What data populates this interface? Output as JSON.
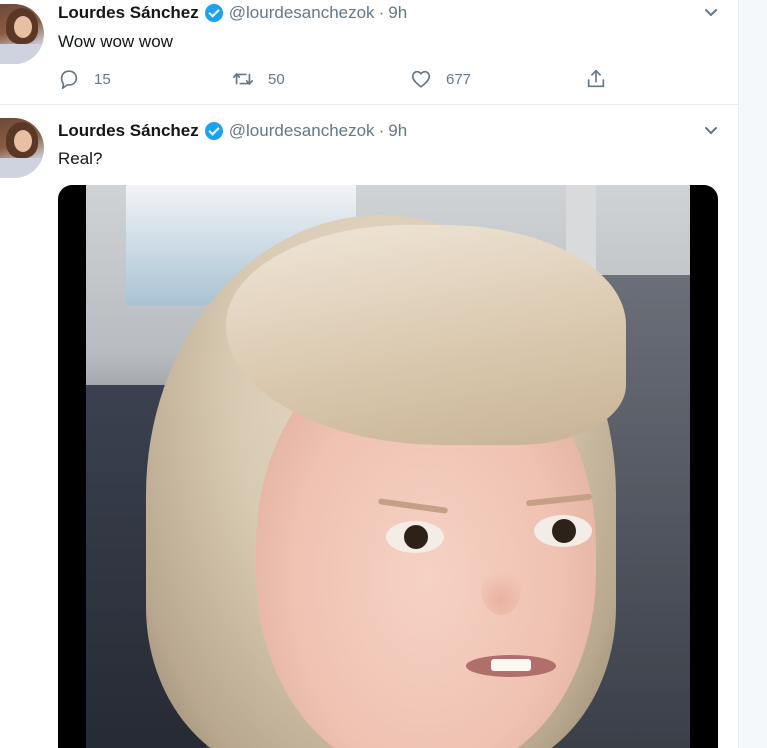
{
  "tweets": [
    {
      "author_name": "Lourdes Sánchez",
      "handle": "@lourdesanchezok",
      "separator": "·",
      "time": "9h",
      "text": "Wow wow wow",
      "actions": {
        "reply_count": "15",
        "retweet_count": "50",
        "like_count": "677"
      }
    },
    {
      "author_name": "Lourdes Sánchez",
      "handle": "@lourdesanchezok",
      "separator": "·",
      "time": "9h",
      "text": "Real?"
    }
  ],
  "icons": {
    "verified": "verified-badge-icon",
    "caret": "chevron-down-icon",
    "reply": "reply-icon",
    "retweet": "retweet-icon",
    "like": "heart-icon",
    "share": "share-icon"
  },
  "colors": {
    "accent": "#1da1f2",
    "secondary_text": "#657786",
    "primary_text": "#14171a",
    "divider": "#e6ecf0"
  }
}
